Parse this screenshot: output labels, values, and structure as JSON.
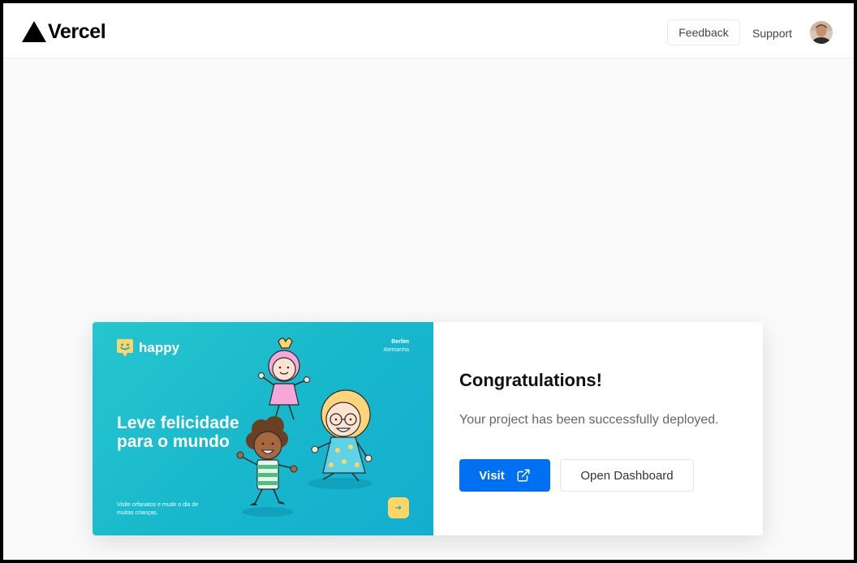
{
  "header": {
    "logo_text": "Vercel",
    "feedback_label": "Feedback",
    "support_label": "Support"
  },
  "preview": {
    "brand": "happy",
    "location_city": "Berlim",
    "location_country": "Alemanha",
    "headline": "Leve felicidade para o mundo",
    "subline": "Visite orfanatos e mude o dia de muitas crianças.",
    "arrow": "➜"
  },
  "deployment": {
    "title": "Congratulations!",
    "description": "Your project has been successfully deployed.",
    "visit_label": "Visit",
    "dashboard_label": "Open Dashboard"
  },
  "colors": {
    "accent": "#0070f3",
    "preview_bg": "#17b7cc",
    "happy_yellow": "#ffd666",
    "page_bg": "#fafafa"
  },
  "icons": [
    "vercel-triangle-icon",
    "external-link-icon",
    "happy-smiley-icon",
    "arrow-right-icon"
  ]
}
